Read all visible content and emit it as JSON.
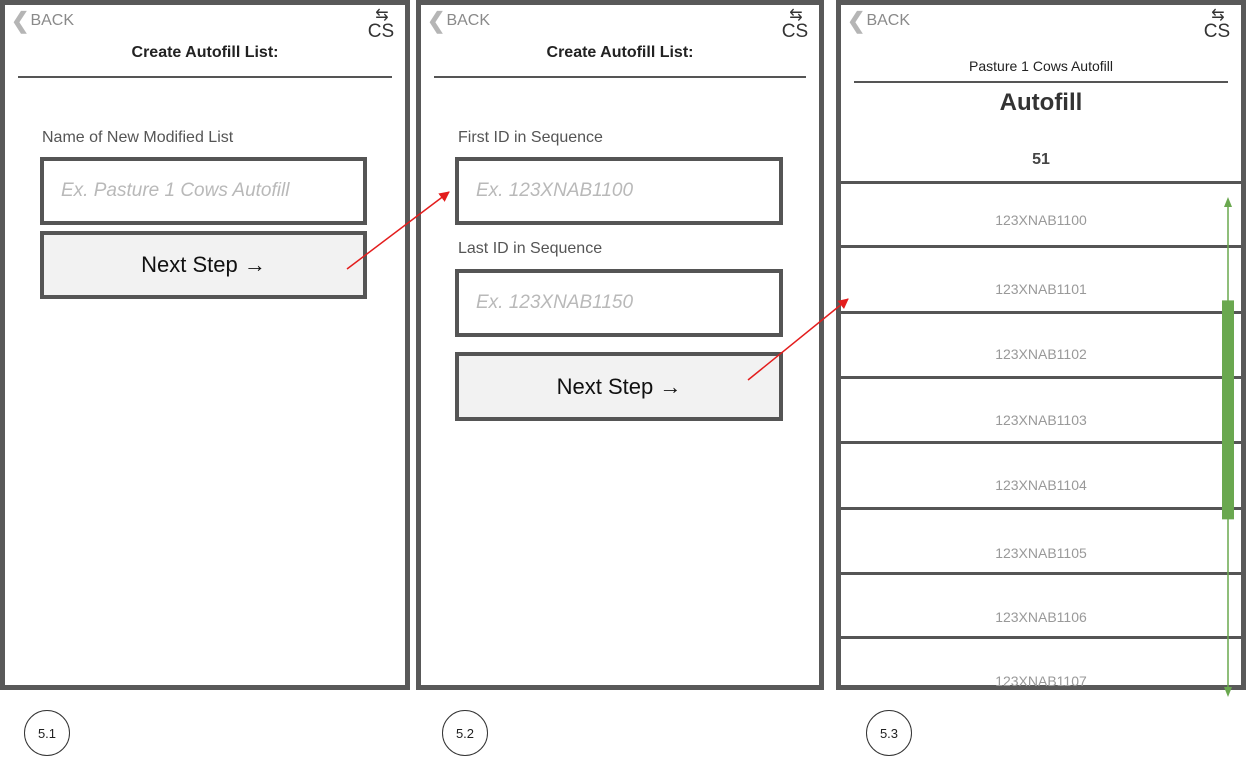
{
  "common": {
    "back_label": "BACK",
    "cs_label": "CS",
    "cs_arrows": "⇆",
    "back_chevron": "❮"
  },
  "screen1": {
    "title": "Create Autofill List:",
    "name_label": "Name of New Modified List",
    "name_placeholder": "Ex. Pasture 1 Cows Autofill",
    "next_button": "Next Step  →",
    "step": "5.1"
  },
  "screen2": {
    "title": "Create Autofill List:",
    "first_label": "First ID in Sequence",
    "first_placeholder": "Ex. 123XNAB1100",
    "last_label": "Last ID in Sequence",
    "last_placeholder": "Ex. 123XNAB1150",
    "next_button": "Next Step  →",
    "step": "5.2"
  },
  "screen3": {
    "subtitle": "Pasture 1 Cows Autofill",
    "title": "Autofill",
    "count": "51",
    "items": [
      "123XNAB1100",
      "123XNAB1101",
      "123XNAB1102",
      "123XNAB1103",
      "123XNAB1104",
      "123XNAB1105",
      "123XNAB1106",
      "123XNAB1107"
    ],
    "scroll_position": 0.12,
    "scroll_visible_fraction": 0.46,
    "step": "5.3"
  },
  "colors": {
    "border": "#595959",
    "flow_arrow": "#e31d1d",
    "scrollbar": "#6aa84f"
  }
}
